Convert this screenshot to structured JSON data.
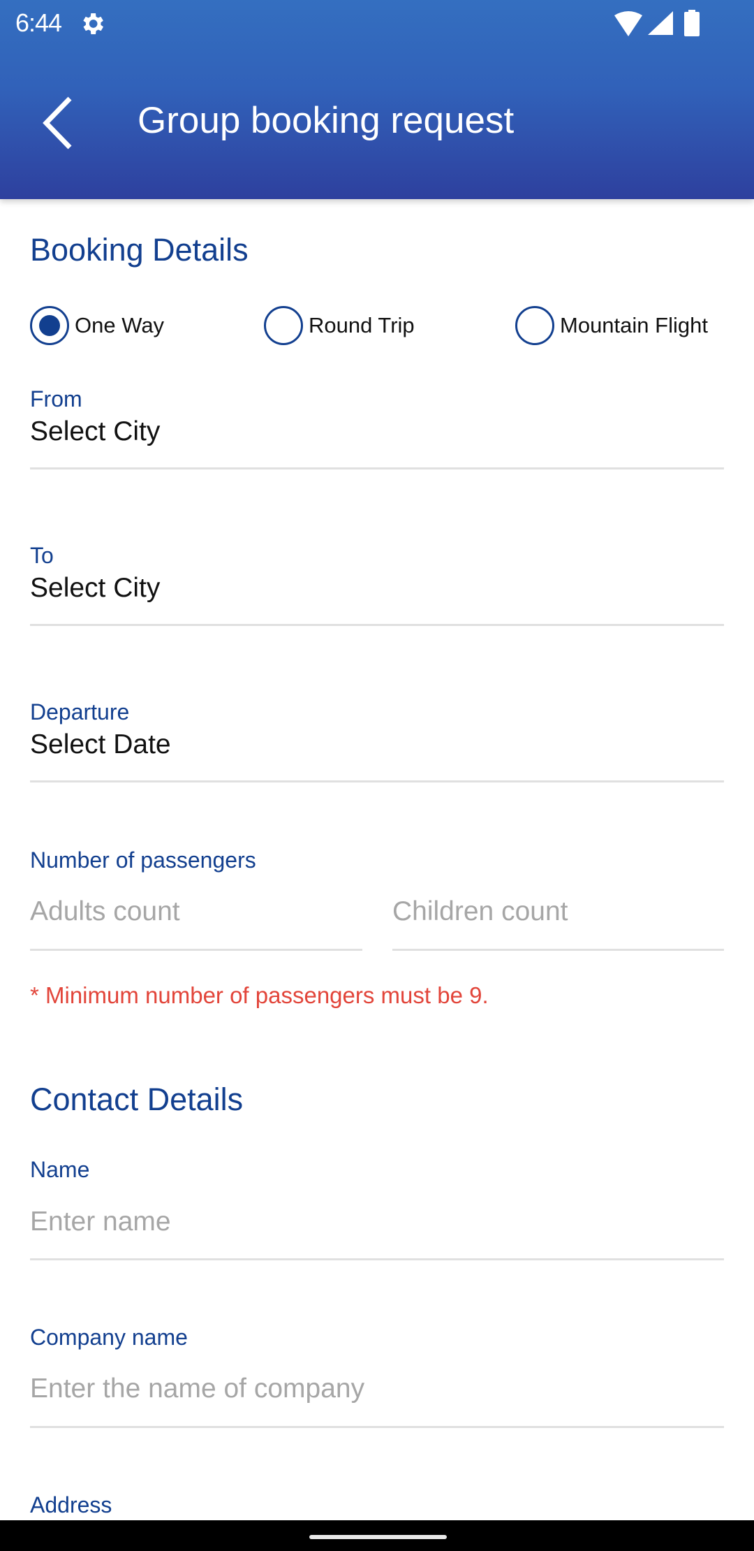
{
  "status_bar": {
    "time": "6:44",
    "icons": [
      "gear-icon",
      "wifi-icon",
      "signal-icon",
      "battery-icon"
    ]
  },
  "app_bar": {
    "back_icon": "chevron-left-icon",
    "title": "Group booking request"
  },
  "colors": {
    "primary": "#123f8f",
    "appbar_top": "#346fc0",
    "appbar_bottom": "#2e409e",
    "error": "#e2453a",
    "placeholder": "#a6a6a6"
  },
  "booking": {
    "heading": "Booking Details",
    "trip_types": [
      {
        "label": "One Way",
        "selected": true
      },
      {
        "label": "Round Trip",
        "selected": false
      },
      {
        "label": "Mountain Flight",
        "selected": false
      }
    ],
    "from": {
      "label": "From",
      "value": "Select City"
    },
    "to": {
      "label": "To",
      "value": "Select City"
    },
    "departure": {
      "label": "Departure",
      "value": "Select Date"
    },
    "passengers": {
      "label": "Number of passengers",
      "adults_placeholder": "Adults count",
      "children_placeholder": "Children count",
      "error": "* Minimum number of passengers must be 9."
    }
  },
  "contact": {
    "heading": "Contact Details",
    "name": {
      "label": "Name",
      "placeholder": "Enter name"
    },
    "company": {
      "label": "Company name",
      "placeholder": "Enter the name of company"
    },
    "address": {
      "label": "Address"
    }
  }
}
